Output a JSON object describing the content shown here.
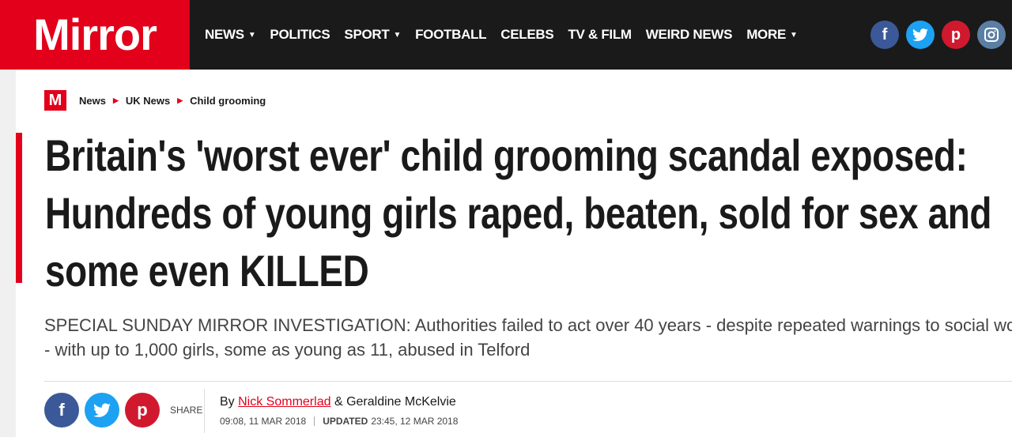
{
  "header": {
    "logo": "Mirror",
    "nav": [
      {
        "label": "NEWS",
        "dropdown": true
      },
      {
        "label": "POLITICS",
        "dropdown": false
      },
      {
        "label": "SPORT",
        "dropdown": true
      },
      {
        "label": "FOOTBALL",
        "dropdown": false
      },
      {
        "label": "CELEBS",
        "dropdown": false
      },
      {
        "label": "TV & FILM",
        "dropdown": false
      },
      {
        "label": "WEIRD NEWS",
        "dropdown": false
      },
      {
        "label": "MORE",
        "dropdown": true
      }
    ],
    "social_icons": [
      "facebook-icon",
      "twitter-icon",
      "pinterest-icon",
      "instagram-icon"
    ]
  },
  "breadcrumb": {
    "badge": "M",
    "items": [
      "News",
      "UK News",
      "Child grooming"
    ]
  },
  "article": {
    "headline_lines": [
      "Britain's 'worst ever' child grooming scandal exposed:",
      "Hundreds of young girls raped, beaten, sold for sex and",
      "some even KILLED"
    ],
    "standfirst_lines": [
      "SPECIAL SUNDAY MIRROR INVESTIGATION: Authorities failed to act over 40 years - despite repeated warnings to social workers",
      "- with up to 1,000 girls, some as young as 11, abused in Telford"
    ],
    "share_label": "SHARE",
    "byline_prefix": "By",
    "author1": "Nick Sommerlad",
    "byline_and": "&",
    "author2": "Geraldine McKelvie",
    "published": "09:08, 11 MAR 2018",
    "updated_label": "UPDATED",
    "updated": "23:45, 12 MAR 2018"
  },
  "colors": {
    "brand_red": "#e2001a",
    "nav_bg": "#1a1a1a",
    "facebook": "#3b5998",
    "twitter": "#1da1f2",
    "pinterest": "#d0192f",
    "instagram": "#5b7ea5"
  }
}
